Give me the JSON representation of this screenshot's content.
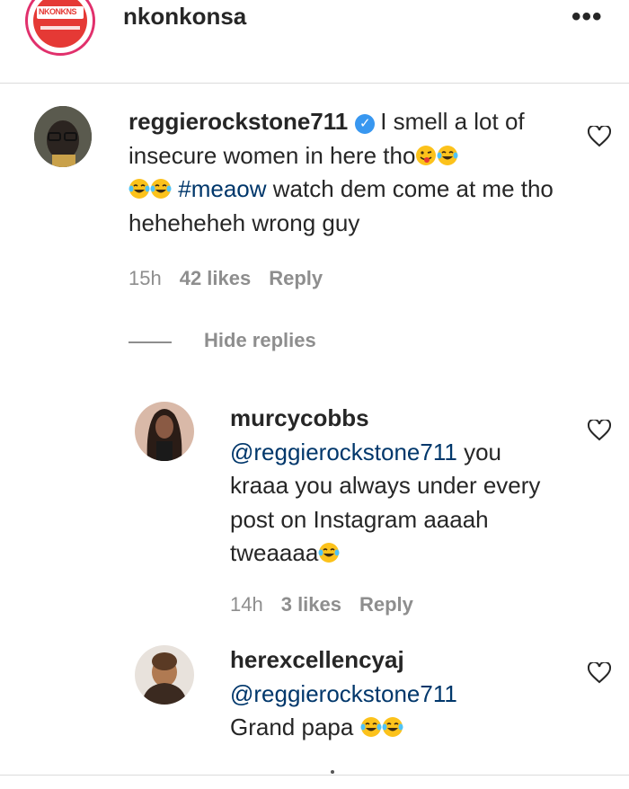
{
  "header": {
    "account_name": "nkonkonsa",
    "logo_text": "NKONKNS",
    "more_icon": "more-horizontal-icon"
  },
  "comment": {
    "username": "reggierockstone711",
    "verified": true,
    "text_part1": "I smell a lot of insecure women in here tho",
    "hashtag": "#meaow",
    "text_part2": "watch dem come at me tho heheheheh wrong guy",
    "time": "15h",
    "likes": "42 likes",
    "reply_label": "Reply"
  },
  "hide_replies_label": "Hide replies",
  "replies": [
    {
      "username": "murcycobbs",
      "mention": "@reggierockstone711",
      "text_part1": "you kraaa you always under every post on Instagram aaaah tweaaaa",
      "time": "14h",
      "likes": "3 likes",
      "reply_label": "Reply"
    },
    {
      "username": "herexcellencyaj",
      "mention": "@reggierockstone711",
      "text_part1": "Grand papa"
    }
  ],
  "colors": {
    "text": "#262626",
    "secondary": "#8e8e8e",
    "link": "#00376b",
    "verified": "#3897f0",
    "divider": "#dbdbdb"
  }
}
